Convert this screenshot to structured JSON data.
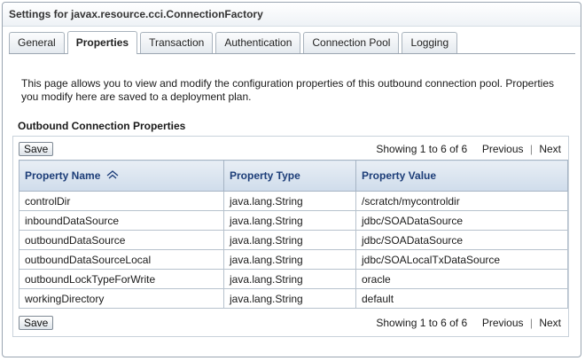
{
  "window": {
    "title": "Settings for javax.resource.cci.ConnectionFactory"
  },
  "tabs": [
    {
      "label": "General",
      "active": false
    },
    {
      "label": "Properties",
      "active": true
    },
    {
      "label": "Transaction",
      "active": false
    },
    {
      "label": "Authentication",
      "active": false
    },
    {
      "label": "Connection Pool",
      "active": false
    },
    {
      "label": "Logging",
      "active": false
    }
  ],
  "page": {
    "description": "This page allows you to view and modify the configuration properties of this outbound connection pool. Properties you modify here are saved to a deployment plan.",
    "section_title": "Outbound Connection Properties"
  },
  "toolbar_top": {
    "save_label": "Save",
    "showing": "Showing 1 to 6 of 6",
    "previous": "Previous",
    "next": "Next"
  },
  "toolbar_bottom": {
    "save_label": "Save",
    "showing": "Showing 1 to 6 of 6",
    "previous": "Previous",
    "next": "Next"
  },
  "table": {
    "columns": [
      "Property Name",
      "Property Type",
      "Property Value"
    ],
    "sort_icon": "sort-ascending-icon",
    "rows": [
      [
        "controlDir",
        "java.lang.String",
        "/scratch/mycontroldir"
      ],
      [
        "inboundDataSource",
        "java.lang.String",
        "jdbc/SOADataSource"
      ],
      [
        "outboundDataSource",
        "java.lang.String",
        "jdbc/SOADataSource"
      ],
      [
        "outboundDataSourceLocal",
        "java.lang.String",
        "jdbc/SOALocalTxDataSource"
      ],
      [
        "outboundLockTypeForWrite",
        "java.lang.String",
        "oracle"
      ],
      [
        "workingDirectory",
        "java.lang.String",
        "default"
      ]
    ]
  },
  "colors": {
    "header_text": "#1c3d78",
    "header_bg": "#d8e3ef",
    "border": "#9aa5b1"
  }
}
